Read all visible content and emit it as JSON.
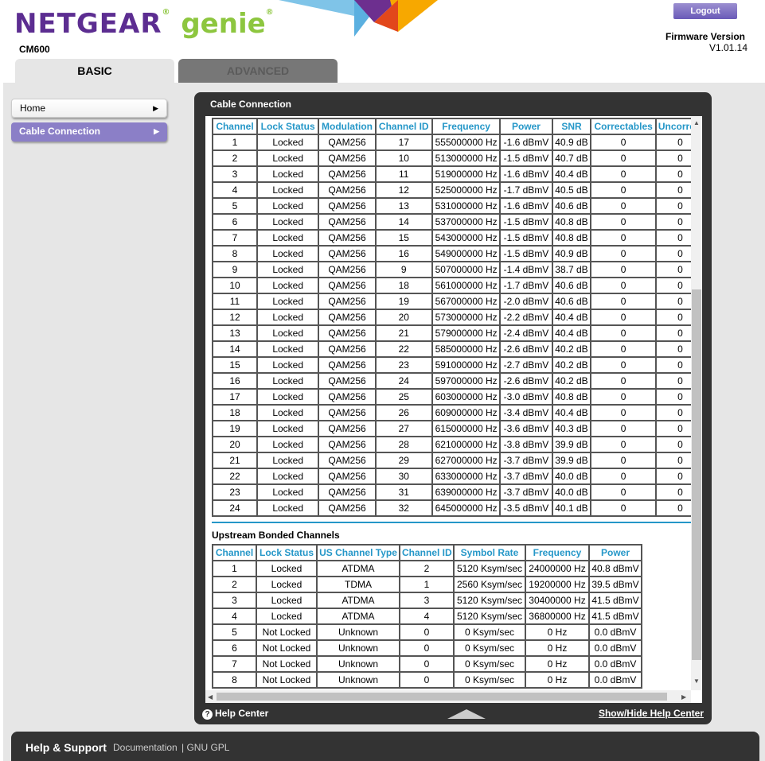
{
  "header": {
    "logo_main": "NETGEAR",
    "logo_sub": "genie",
    "model": "CM600",
    "logout_label": "Logout",
    "firmware_label": "Firmware Version",
    "firmware_value": "V1.01.14",
    "tabs": [
      {
        "label": "BASIC"
      },
      {
        "label": "ADVANCED"
      }
    ]
  },
  "sidebar": {
    "items": [
      {
        "label": "Home"
      },
      {
        "label": "Cable Connection"
      }
    ]
  },
  "panel": {
    "title": "Cable Connection",
    "help_center": "Help Center",
    "show_hide": "Show/Hide Help Center"
  },
  "downstream": {
    "headers": [
      "Channel",
      "Lock Status",
      "Modulation",
      "Channel ID",
      "Frequency",
      "Power",
      "SNR",
      "Correctables",
      "Uncorrectables"
    ],
    "rows": [
      [
        "1",
        "Locked",
        "QAM256",
        "17",
        "555000000 Hz",
        "-1.6 dBmV",
        "40.9 dB",
        "0",
        "0"
      ],
      [
        "2",
        "Locked",
        "QAM256",
        "10",
        "513000000 Hz",
        "-1.5 dBmV",
        "40.7 dB",
        "0",
        "0"
      ],
      [
        "3",
        "Locked",
        "QAM256",
        "11",
        "519000000 Hz",
        "-1.6 dBmV",
        "40.4 dB",
        "0",
        "0"
      ],
      [
        "4",
        "Locked",
        "QAM256",
        "12",
        "525000000 Hz",
        "-1.7 dBmV",
        "40.5 dB",
        "0",
        "0"
      ],
      [
        "5",
        "Locked",
        "QAM256",
        "13",
        "531000000 Hz",
        "-1.6 dBmV",
        "40.6 dB",
        "0",
        "0"
      ],
      [
        "6",
        "Locked",
        "QAM256",
        "14",
        "537000000 Hz",
        "-1.5 dBmV",
        "40.8 dB",
        "0",
        "0"
      ],
      [
        "7",
        "Locked",
        "QAM256",
        "15",
        "543000000 Hz",
        "-1.5 dBmV",
        "40.8 dB",
        "0",
        "0"
      ],
      [
        "8",
        "Locked",
        "QAM256",
        "16",
        "549000000 Hz",
        "-1.5 dBmV",
        "40.9 dB",
        "0",
        "0"
      ],
      [
        "9",
        "Locked",
        "QAM256",
        "9",
        "507000000 Hz",
        "-1.4 dBmV",
        "38.7 dB",
        "0",
        "0"
      ],
      [
        "10",
        "Locked",
        "QAM256",
        "18",
        "561000000 Hz",
        "-1.7 dBmV",
        "40.6 dB",
        "0",
        "0"
      ],
      [
        "11",
        "Locked",
        "QAM256",
        "19",
        "567000000 Hz",
        "-2.0 dBmV",
        "40.6 dB",
        "0",
        "0"
      ],
      [
        "12",
        "Locked",
        "QAM256",
        "20",
        "573000000 Hz",
        "-2.2 dBmV",
        "40.4 dB",
        "0",
        "0"
      ],
      [
        "13",
        "Locked",
        "QAM256",
        "21",
        "579000000 Hz",
        "-2.4 dBmV",
        "40.4 dB",
        "0",
        "0"
      ],
      [
        "14",
        "Locked",
        "QAM256",
        "22",
        "585000000 Hz",
        "-2.6 dBmV",
        "40.2 dB",
        "0",
        "0"
      ],
      [
        "15",
        "Locked",
        "QAM256",
        "23",
        "591000000 Hz",
        "-2.7 dBmV",
        "40.2 dB",
        "0",
        "0"
      ],
      [
        "16",
        "Locked",
        "QAM256",
        "24",
        "597000000 Hz",
        "-2.6 dBmV",
        "40.2 dB",
        "0",
        "0"
      ],
      [
        "17",
        "Locked",
        "QAM256",
        "25",
        "603000000 Hz",
        "-3.0 dBmV",
        "40.8 dB",
        "0",
        "0"
      ],
      [
        "18",
        "Locked",
        "QAM256",
        "26",
        "609000000 Hz",
        "-3.4 dBmV",
        "40.4 dB",
        "0",
        "0"
      ],
      [
        "19",
        "Locked",
        "QAM256",
        "27",
        "615000000 Hz",
        "-3.6 dBmV",
        "40.3 dB",
        "0",
        "0"
      ],
      [
        "20",
        "Locked",
        "QAM256",
        "28",
        "621000000 Hz",
        "-3.8 dBmV",
        "39.9 dB",
        "0",
        "0"
      ],
      [
        "21",
        "Locked",
        "QAM256",
        "29",
        "627000000 Hz",
        "-3.7 dBmV",
        "39.9 dB",
        "0",
        "0"
      ],
      [
        "22",
        "Locked",
        "QAM256",
        "30",
        "633000000 Hz",
        "-3.7 dBmV",
        "40.0 dB",
        "0",
        "0"
      ],
      [
        "23",
        "Locked",
        "QAM256",
        "31",
        "639000000 Hz",
        "-3.7 dBmV",
        "40.0 dB",
        "0",
        "0"
      ],
      [
        "24",
        "Locked",
        "QAM256",
        "32",
        "645000000 Hz",
        "-3.5 dBmV",
        "40.1 dB",
        "0",
        "0"
      ]
    ]
  },
  "upstream": {
    "title": "Upstream Bonded Channels",
    "headers": [
      "Channel",
      "Lock Status",
      "US Channel Type",
      "Channel ID",
      "Symbol Rate",
      "Frequency",
      "Power"
    ],
    "rows": [
      [
        "1",
        "Locked",
        "ATDMA",
        "2",
        "5120 Ksym/sec",
        "24000000 Hz",
        "40.8 dBmV"
      ],
      [
        "2",
        "Locked",
        "TDMA",
        "1",
        "2560 Ksym/sec",
        "19200000 Hz",
        "39.5 dBmV"
      ],
      [
        "3",
        "Locked",
        "ATDMA",
        "3",
        "5120 Ksym/sec",
        "30400000 Hz",
        "41.5 dBmV"
      ],
      [
        "4",
        "Locked",
        "ATDMA",
        "4",
        "5120 Ksym/sec",
        "36800000 Hz",
        "41.5 dBmV"
      ],
      [
        "5",
        "Not Locked",
        "Unknown",
        "0",
        "0 Ksym/sec",
        "0 Hz",
        "0.0 dBmV"
      ],
      [
        "6",
        "Not Locked",
        "Unknown",
        "0",
        "0 Ksym/sec",
        "0 Hz",
        "0.0 dBmV"
      ],
      [
        "7",
        "Not Locked",
        "Unknown",
        "0",
        "0 Ksym/sec",
        "0 Hz",
        "0.0 dBmV"
      ],
      [
        "8",
        "Not Locked",
        "Unknown",
        "0",
        "0 Ksym/sec",
        "0 Hz",
        "0.0 dBmV"
      ]
    ]
  },
  "footer": {
    "help_support": "Help & Support",
    "documentation": "Documentation",
    "gpl": "| GNU GPL"
  },
  "colors": {
    "accent": "#5c2d91",
    "genie_green": "#8dc63f",
    "header_blue": "#2597c8",
    "sidebar_active": "#8b7fc7",
    "panel_dark": "#333333"
  },
  "icons": [
    "help-icon",
    "chevron-right-icon",
    "scroll-up-arrow-icon",
    "scroll-down-arrow-icon",
    "collapse-triangle-icon"
  ]
}
